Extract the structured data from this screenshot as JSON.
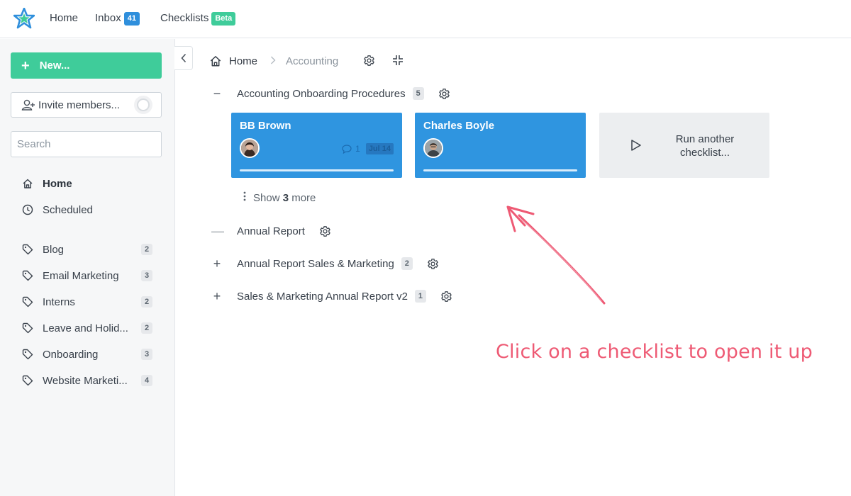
{
  "topbar": {
    "nav": [
      {
        "label": "Home"
      },
      {
        "label": "Inbox",
        "badge": "41"
      },
      {
        "label": "Checklists",
        "badge": "Beta"
      }
    ]
  },
  "sidebar": {
    "new_label": "New...",
    "invite_label": "Invite members...",
    "search_placeholder": "Search",
    "main_links": [
      {
        "label": "Home",
        "icon": "home-icon"
      },
      {
        "label": "Scheduled",
        "icon": "clock-icon"
      }
    ],
    "tags": [
      {
        "label": "Blog",
        "count": "2"
      },
      {
        "label": "Email Marketing",
        "count": "3"
      },
      {
        "label": "Interns",
        "count": "2"
      },
      {
        "label": "Leave and Holid...",
        "count": "2"
      },
      {
        "label": "Onboarding",
        "count": "3"
      },
      {
        "label": "Website Marketi...",
        "count": "4"
      }
    ]
  },
  "breadcrumb": {
    "home": "Home",
    "current": "Accounting"
  },
  "groups": [
    {
      "toggle": "−",
      "title": "Accounting Onboarding Procedures",
      "count": "5"
    },
    {
      "toggle": "—",
      "title": "Annual Report",
      "count": ""
    },
    {
      "toggle": "+",
      "title": "Annual Report Sales & Marketing",
      "count": "2"
    },
    {
      "toggle": "+",
      "title": "Sales & Marketing Annual Report v2",
      "count": "1"
    }
  ],
  "cards": [
    {
      "name": "BB Brown",
      "comments": "1",
      "date": "Jul 14"
    },
    {
      "name": "Charles Boyle"
    }
  ],
  "run_another": "Run another checklist...",
  "show_more": {
    "prefix": "Show",
    "count": "3",
    "suffix": "more"
  },
  "annotation": "Click on a checklist to open it up",
  "colors": {
    "accent_blue": "#2f95e0",
    "accent_green": "#3fcc9a",
    "annotation_pink": "#ee5a74"
  }
}
